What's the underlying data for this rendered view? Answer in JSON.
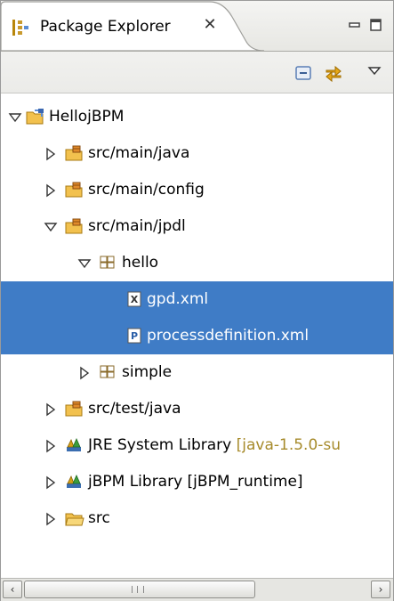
{
  "view": {
    "title": "Package Explorer",
    "close_glyph": "✕"
  },
  "toolbar": {
    "collapse_all_tooltip": "Collapse All",
    "link_editor_tooltip": "Link with Editor",
    "view_menu_tooltip": "View Menu"
  },
  "tree": {
    "project": "HellojBPM",
    "src_main_java": "src/main/java",
    "src_main_config": "src/main/config",
    "src_main_jpdl": "src/main/jpdl",
    "pkg_hello": "hello",
    "file_gpd": "gpd.xml",
    "file_processdefinition": "processdefinition.xml",
    "pkg_simple": "simple",
    "src_test_java": "src/test/java",
    "jre_lib": "JRE System Library",
    "jre_lib_decoration": "[java-1.5.0-su",
    "jbpm_lib": "jBPM Library [jBPM_runtime]",
    "src_folder": "src"
  },
  "scrollbar": {
    "left_arrow": "‹",
    "right_arrow": "›"
  },
  "colors": {
    "selection": "#3f7cc6",
    "decoration": "#a68a2a",
    "folder": "#f2c14e",
    "package_folder_dot": "#c0392b",
    "library": "#d4a017"
  }
}
